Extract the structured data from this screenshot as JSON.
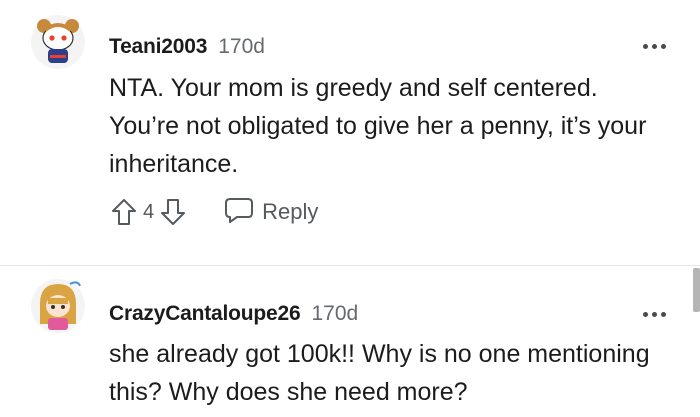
{
  "comments": [
    {
      "username": "Teani2003",
      "time": "170d",
      "body": "NTA. Your mom is greedy and self centered. You’re not obligated to give her a penny, it’s your inheritance.",
      "score": "4",
      "reply_label": "Reply"
    },
    {
      "username": "CrazyCantaloupe26",
      "time": "170d",
      "body": "she already got 100k!! Why is no one mentioning this? Why does she need more?"
    }
  ],
  "icons": [
    "more-options-icon",
    "upvote-icon",
    "downvote-icon",
    "reply-icon"
  ],
  "colors": {
    "text": "#1c1c1c",
    "muted": "#666a6d",
    "divider": "#e5e5e5"
  }
}
